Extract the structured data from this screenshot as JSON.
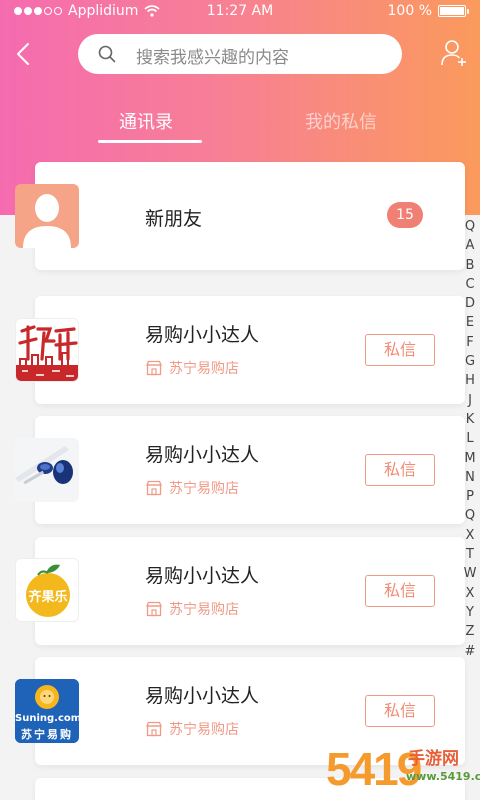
{
  "status_bar": {
    "carrier": "Applidium",
    "time": "11:27 AM",
    "battery": "100 %",
    "signal_bars": 3,
    "battery_level": 1.0
  },
  "search": {
    "placeholder": "搜索我感兴趣的内容"
  },
  "tabs": [
    {
      "label": "通讯录",
      "active": true
    },
    {
      "label": "我的私信",
      "active": false
    }
  ],
  "new_friends": {
    "label": "新朋友",
    "count": "15"
  },
  "contacts": [
    {
      "name": "易购小小达人",
      "store": "苏宁易购店",
      "button": "私信",
      "avatar": "calligraphy-logo"
    },
    {
      "name": "易购小小达人",
      "store": "苏宁易购店",
      "button": "私信",
      "avatar": "cosmetics-photo"
    },
    {
      "name": "易购小小达人",
      "store": "苏宁易购店",
      "button": "私信",
      "avatar": "fruit-logo"
    },
    {
      "name": "易购小小达人",
      "store": "苏宁易购店",
      "button": "私信",
      "avatar": "suning-logo"
    }
  ],
  "avatar_text": {
    "fruit": "齐果乐",
    "suning_top": "Suning.com",
    "suning_bottom": "苏宁易购"
  },
  "index_letters": [
    "Q",
    "A",
    "B",
    "C",
    "D",
    "E",
    "F",
    "G",
    "H",
    "J",
    "K",
    "L",
    "M",
    "N",
    "P",
    "Q",
    "X",
    "T",
    "W",
    "X",
    "Y",
    "Z",
    "#"
  ],
  "watermark": {
    "number": "5419",
    "cn": "手游网",
    "url": "www.5419.cn"
  },
  "colors": {
    "gradient_start": "#f56bb0",
    "gradient_end": "#fb9a5c",
    "accent": "#f08c74",
    "badge": "#f07f74"
  }
}
